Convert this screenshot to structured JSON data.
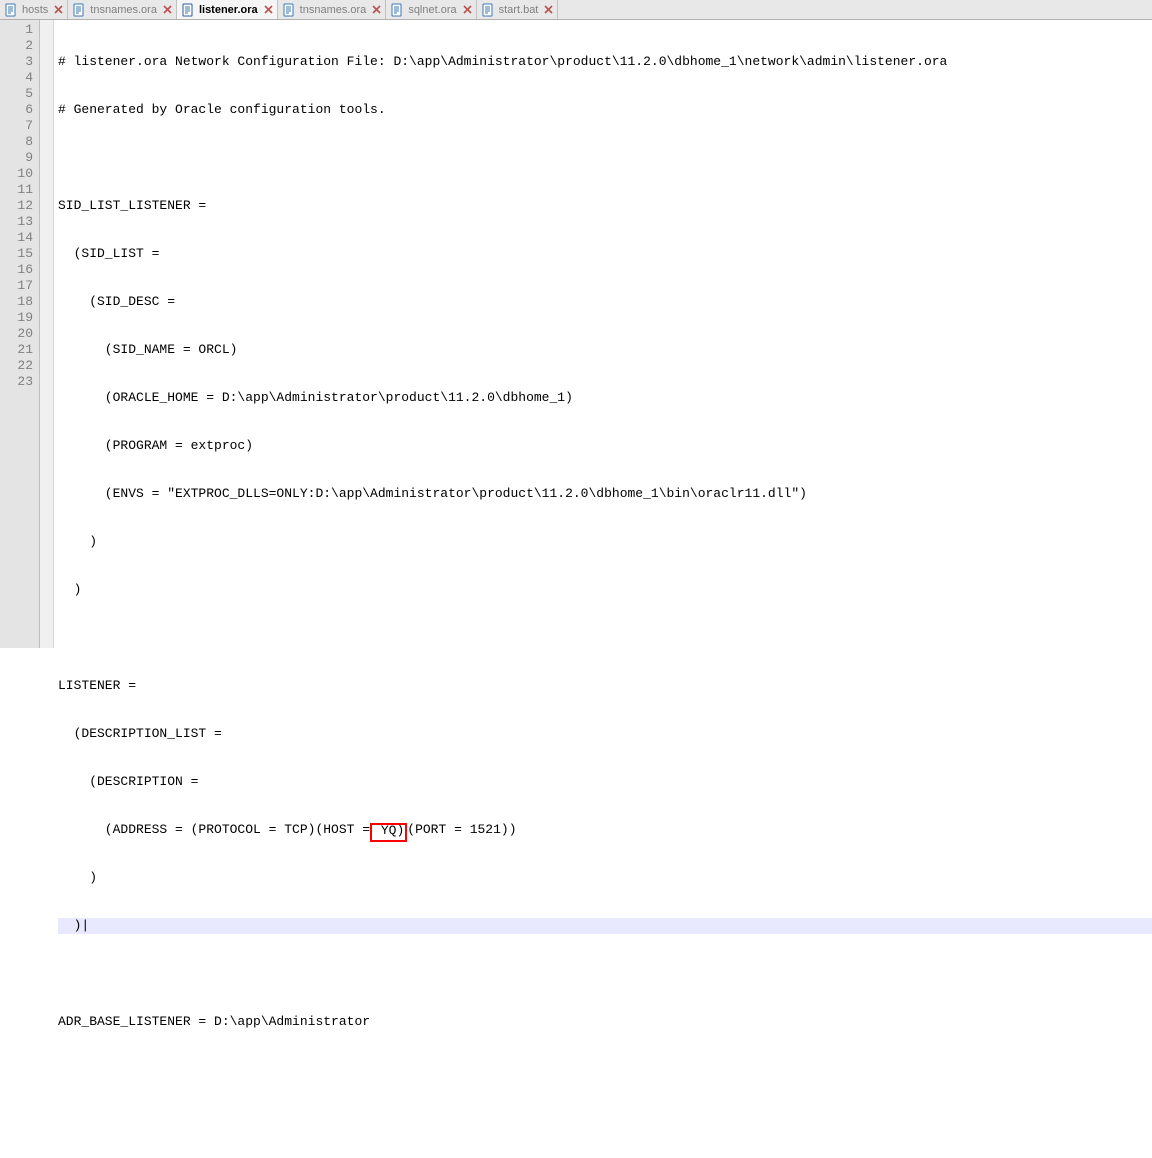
{
  "tabs": [
    {
      "label": "hosts",
      "active": false
    },
    {
      "label": "tnsnames.ora",
      "active": false
    },
    {
      "label": "listener.ora",
      "active": true
    },
    {
      "label": "tnsnames.ora",
      "active": false
    },
    {
      "label": "sqlnet.ora",
      "active": false
    },
    {
      "label": "start.bat",
      "active": false
    }
  ],
  "gutter": {
    "1": "1",
    "2": "2",
    "3": "3",
    "4": "4",
    "5": "5",
    "6": "6",
    "7": "7",
    "8": "8",
    "9": "9",
    "10": "10",
    "11": "11",
    "12": "12",
    "13": "13",
    "14": "14",
    "15": "15",
    "16": "16",
    "17": "17",
    "18": "18",
    "19": "19",
    "20": "20",
    "21": "21",
    "22": "22",
    "23": "23"
  },
  "code": {
    "l1": "# listener.ora Network Configuration File: D:\\app\\Administrator\\product\\11.2.0\\dbhome_1\\network\\admin\\listener.ora",
    "l2": "# Generated by Oracle configuration tools.",
    "l3": "",
    "l4": "SID_LIST_LISTENER =",
    "l5": "  (SID_LIST =",
    "l6": "    (SID_DESC =",
    "l7": "      (SID_NAME = ORCL)",
    "l8": "      (ORACLE_HOME = D:\\app\\Administrator\\product\\11.2.0\\dbhome_1)",
    "l9": "      (PROGRAM = extproc)",
    "l10": "      (ENVS = \"EXTPROC_DLLS=ONLY:D:\\app\\Administrator\\product\\11.2.0\\dbhome_1\\bin\\oraclr11.dll\")",
    "l11": "    )",
    "l12": "  )",
    "l13": "",
    "l14": "LISTENER =",
    "l15": "  (DESCRIPTION_LIST =",
    "l16": "    (DESCRIPTION =",
    "l17_pre": "      (ADDRESS = (PROTOCOL = TCP)(HOST =",
    "l17_host": " YQ)",
    "l17_post": "(PORT = 1521))",
    "l18": "    )",
    "l19": "  )",
    "l20": "",
    "l21": "ADR_BASE_LISTENER = D:\\app\\Administrator",
    "l22": "",
    "l23": ""
  },
  "highlight": {
    "box_line": 17,
    "caret_line": 19
  }
}
